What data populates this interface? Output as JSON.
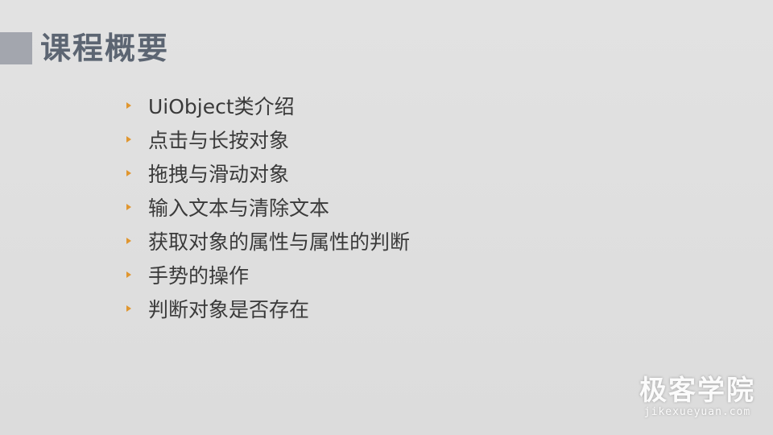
{
  "slide": {
    "title": "课程概要",
    "bullets": [
      "UiObject类介绍",
      "点击与长按对象",
      "拖拽与滑动对象",
      "输入文本与清除文本",
      "获取对象的属性与属性的判断",
      "手势的操作",
      "判断对象是否存在"
    ]
  },
  "watermark": {
    "name": "极客学院",
    "url": "jikexueyuan.com"
  },
  "colors": {
    "background": "#dfdfdf",
    "title": "#5c6572",
    "accent_block": "#a3a6ae",
    "bullet_arrow": "#e0962f",
    "text": "#3a3a3a"
  }
}
